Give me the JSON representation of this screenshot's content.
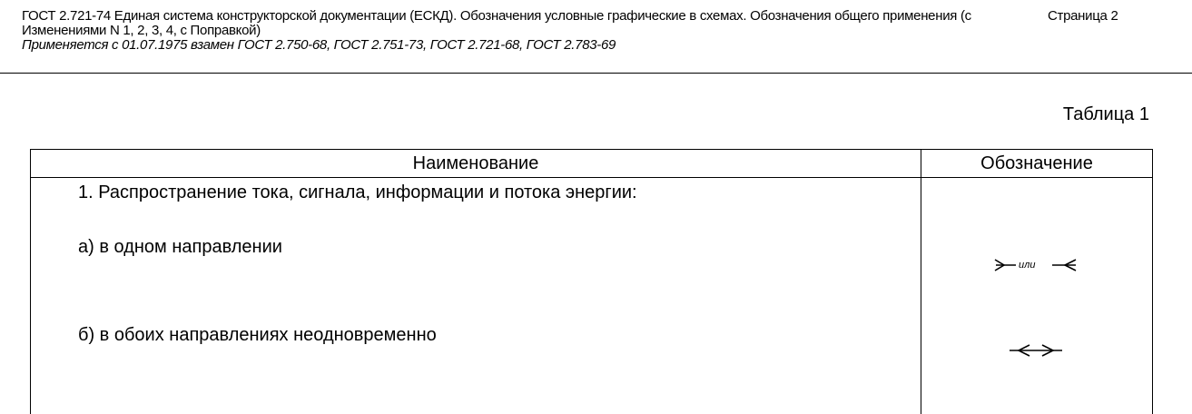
{
  "header": {
    "title": "ГОСТ 2.721-74 Единая система конструкторской документации (ЕСКД). Обозначения условные графические в схемах. Обозначения общего применения (с Изменениями N 1, 2, 3, 4, с Поправкой)",
    "subtitle": "Применяется с 01.07.1975 взамен ГОСТ 2.750-68, ГОСТ 2.751-73, ГОСТ 2.721-68, ГОСТ 2.783-69",
    "page": "Страница 2"
  },
  "table": {
    "caption": "Таблица 1",
    "columns": {
      "name": "Наименование",
      "symbol": "Обозначение"
    },
    "rows": {
      "item1": "1. Распространение тока, сигнала, информации и потока энергии:",
      "item_a": "а) в одном направлении",
      "item_b": "б) в обоих направлениях неодновременно",
      "symbol_a_word": "или"
    }
  },
  "icons": {
    "symbol_a": "one-direction-arrow-symbol",
    "symbol_b": "both-directions-non-simultaneous-symbol"
  }
}
